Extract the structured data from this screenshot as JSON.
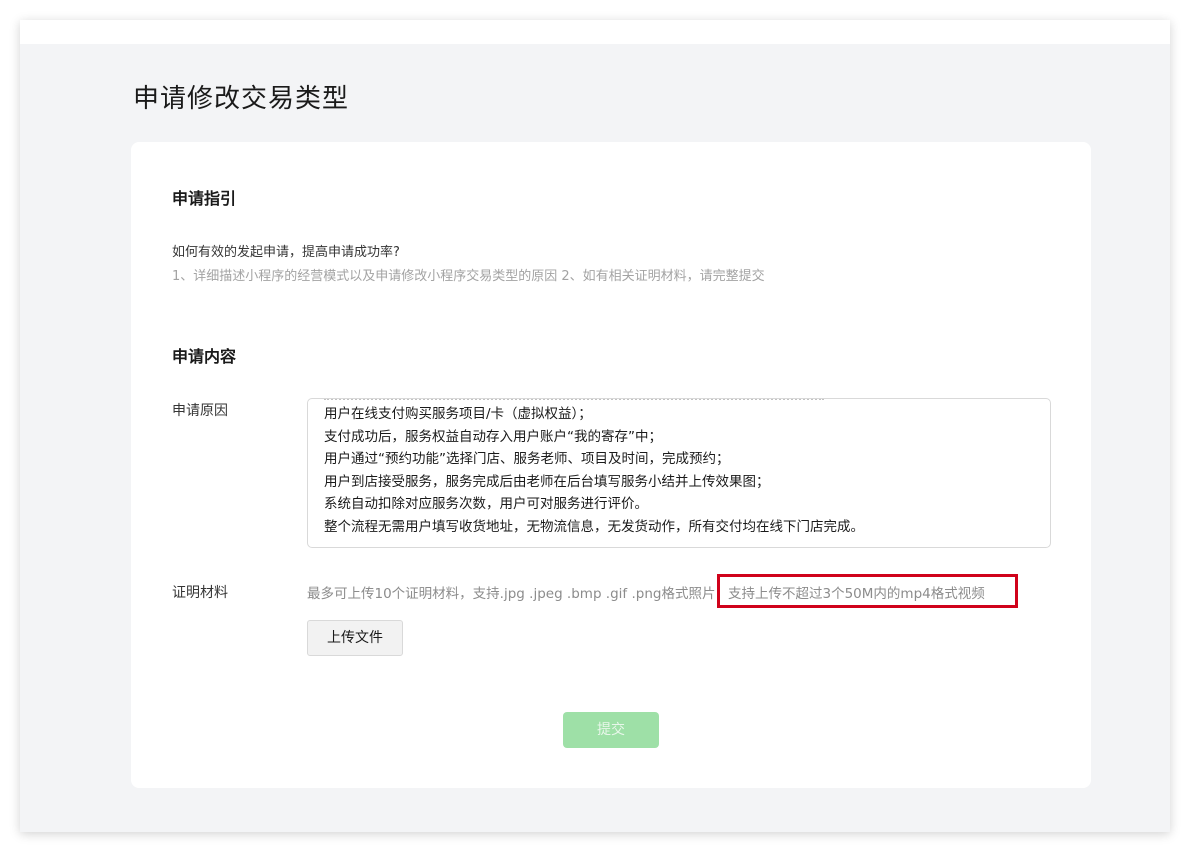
{
  "page": {
    "title": "申请修改交易类型"
  },
  "guide": {
    "title": "申请指引",
    "question": "如何有效的发起申请，提高申请成功率?",
    "description": "1、详细描述小程序的经营模式以及申请修改小程序交易类型的原因 2、如有相关证明材料，请完整提交"
  },
  "content": {
    "title": "申请内容",
    "reason": {
      "label": "申请原因",
      "lines": [
        "用户在线支付购买服务项目/卡（虚拟权益）；",
        "支付成功后，服务权益自动存入用户账户“我的寄存”中；",
        "用户通过“预约功能”选择门店、服务老师、项目及时间，完成预约；",
        "用户到店接受服务，服务完成后由老师在后台填写服务小结并上传效果图；",
        "系统自动扣除对应服务次数，用户可对服务进行评价。",
        "整个流程无需用户填写收货地址，无物流信息，无发货动作，所有交付均在线下门店完成。"
      ]
    },
    "proof": {
      "label": "证明材料",
      "hint": "最多可上传10个证明材料，支持.jpg .jpeg .bmp .gif .png格式照片，",
      "video_hint": "支持上传不超过3个50M内的mp4格式视频",
      "upload_label": "上传文件"
    }
  },
  "actions": {
    "submit_label": "提交"
  },
  "colors": {
    "highlight_border": "#d0021b",
    "submit_disabled": "#9ee0a7"
  }
}
